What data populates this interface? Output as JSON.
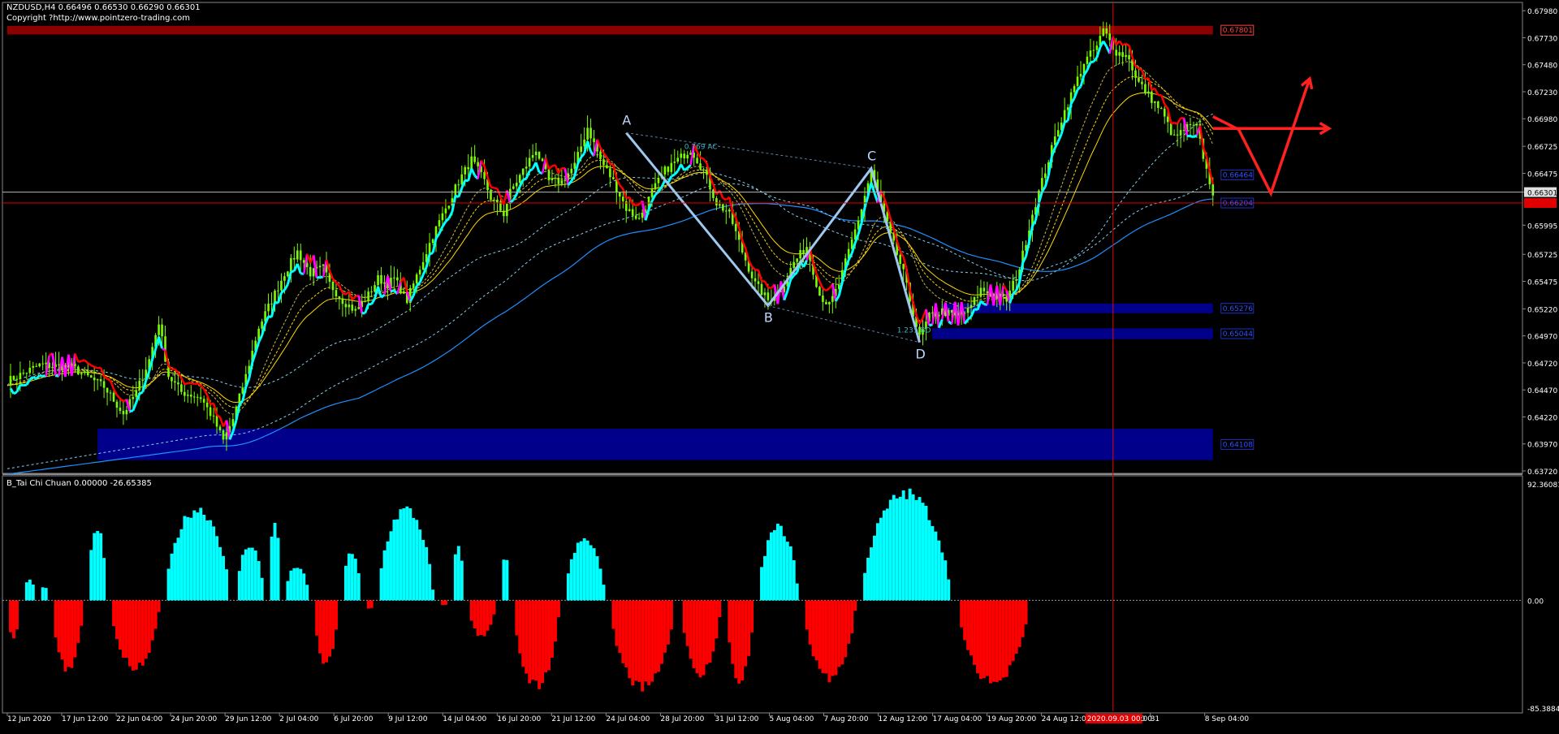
{
  "header": {
    "symbol_line": "NZDUSD,H4  0.66496 0.66530 0.66290 0.66301",
    "copyright": "Copyright ?http://www.pointzero-trading.com",
    "indicator_line": "B_Tai Chi Chuan 0.00000 -26.65385"
  },
  "colors": {
    "background": "#000000",
    "bull_bar": "#7CFC00",
    "trail_bull": "#00FFFF",
    "trail_bear": "#FF0000",
    "trail_transition": "#FF00FF",
    "zone": "#00008B",
    "resistance_zone": "#8B0000",
    "hist_pos": "#00FFFF",
    "hist_neg": "#FF0000",
    "ma_slow": "#1E90FF",
    "ma_dashed": "#87CEEB",
    "ma_yellow": "#FFD700",
    "projection": "#FF2020"
  },
  "chart_data": [
    {
      "type": "candlestick",
      "name": "NZDUSD,H4",
      "ylim": [
        0.6372,
        0.68004
      ],
      "y_ticks": [
        "0.67980",
        "0.67730",
        "0.67480",
        "0.67230",
        "0.66980",
        "0.66725",
        "0.66475",
        "0.66301",
        "0.65995",
        "0.65725",
        "0.65475",
        "0.65220",
        "0.64970",
        "0.64720",
        "0.64470",
        "0.64220",
        "0.63970",
        "0.63720"
      ],
      "current_price": "0.66301",
      "x_ticks": [
        "12 Jun 2020",
        "17 Jun 12:00",
        "22 Jun 04:00",
        "24 Jun 20:00",
        "29 Jun 12:00",
        "2 Jul 04:00",
        "6 Jul 20:00",
        "9 Jul 12:00",
        "14 Jul 04:00",
        "16 Jul 20:00",
        "21 Jul 12:00",
        "24 Jul 04:00",
        "28 Jul 20:00",
        "31 Jul 12:00",
        "5 Aug 04:00",
        "7 Aug 20:00",
        "12 Aug 12:00",
        "17 Aug 04:00",
        "19 Aug 20:00",
        "24 Aug 12:00",
        "27 Aug 04:00",
        "31",
        "8 Sep 04:00"
      ],
      "highlighted_time": "2020.09.03 00:00",
      "price_path": [
        [
          0,
          0.6455
        ],
        [
          10,
          0.647
        ],
        [
          20,
          0.6468
        ],
        [
          30,
          0.645
        ],
        [
          36,
          0.6425
        ],
        [
          40,
          0.6445
        ],
        [
          44,
          0.6475
        ],
        [
          47,
          0.651
        ],
        [
          50,
          0.646
        ],
        [
          54,
          0.6445
        ],
        [
          60,
          0.644
        ],
        [
          64,
          0.642
        ],
        [
          67,
          0.64
        ],
        [
          70,
          0.642
        ],
        [
          74,
          0.646
        ],
        [
          78,
          0.6505
        ],
        [
          82,
          0.653
        ],
        [
          86,
          0.6555
        ],
        [
          90,
          0.6575
        ],
        [
          94,
          0.6555
        ],
        [
          98,
          0.656
        ],
        [
          100,
          0.6545
        ],
        [
          104,
          0.653
        ],
        [
          108,
          0.652
        ],
        [
          112,
          0.6535
        ],
        [
          115,
          0.655
        ],
        [
          118,
          0.6545
        ],
        [
          120,
          0.655
        ],
        [
          124,
          0.653
        ],
        [
          128,
          0.656
        ],
        [
          132,
          0.659
        ],
        [
          136,
          0.6615
        ],
        [
          140,
          0.664
        ],
        [
          144,
          0.666
        ],
        [
          148,
          0.664
        ],
        [
          150,
          0.6625
        ],
        [
          154,
          0.661
        ],
        [
          156,
          0.663
        ],
        [
          160,
          0.665
        ],
        [
          164,
          0.667
        ],
        [
          166,
          0.6655
        ],
        [
          168,
          0.664
        ],
        [
          172,
          0.664
        ],
        [
          176,
          0.6655
        ],
        [
          180,
          0.669
        ],
        [
          184,
          0.666
        ],
        [
          188,
          0.664
        ],
        [
          192,
          0.6615
        ],
        [
          196,
          0.6605
        ],
        [
          200,
          0.663
        ],
        [
          204,
          0.665
        ],
        [
          208,
          0.666
        ],
        [
          212,
          0.667
        ],
        [
          216,
          0.665
        ],
        [
          220,
          0.662
        ],
        [
          224,
          0.661
        ],
        [
          228,
          0.6575
        ],
        [
          232,
          0.6545
        ],
        [
          236,
          0.653
        ],
        [
          240,
          0.654
        ],
        [
          244,
          0.6565
        ],
        [
          248,
          0.658
        ],
        [
          252,
          0.6535
        ],
        [
          255,
          0.6525
        ],
        [
          258,
          0.6545
        ],
        [
          262,
          0.6585
        ],
        [
          265,
          0.6615
        ],
        [
          268,
          0.665
        ],
        [
          270,
          0.663
        ],
        [
          274,
          0.659
        ],
        [
          278,
          0.6555
        ],
        [
          280,
          0.653
        ],
        [
          283,
          0.6495
        ],
        [
          286,
          0.6515
        ],
        [
          290,
          0.652
        ],
        [
          294,
          0.6515
        ],
        [
          298,
          0.652
        ],
        [
          302,
          0.654
        ],
        [
          306,
          0.6535
        ],
        [
          310,
          0.653
        ],
        [
          314,
          0.656
        ],
        [
          318,
          0.661
        ],
        [
          322,
          0.665
        ],
        [
          326,
          0.669
        ],
        [
          330,
          0.672
        ],
        [
          334,
          0.675
        ],
        [
          338,
          0.6765
        ],
        [
          340,
          0.678
        ],
        [
          344,
          0.676
        ],
        [
          348,
          0.6755
        ],
        [
          350,
          0.6735
        ],
        [
          354,
          0.672
        ],
        [
          358,
          0.6705
        ],
        [
          362,
          0.668
        ],
        [
          366,
          0.669
        ],
        [
          369,
          0.669
        ],
        [
          372,
          0.665
        ],
        [
          374,
          0.663
        ]
      ],
      "pattern_points": [
        {
          "label": "A",
          "bar": 192,
          "price": 0.6685
        },
        {
          "label": "B",
          "bar": 236,
          "price": 0.6525
        },
        {
          "label": "C",
          "bar": 268,
          "price": 0.6652
        },
        {
          "label": "D",
          "bar": 283,
          "price": 0.6491
        }
      ],
      "pattern_ratios": [
        {
          "label": "0.769 AC",
          "bar": 210,
          "price": 0.667
        },
        {
          "label": "1.231 BD",
          "bar": 276,
          "price": 0.65
        }
      ],
      "zones": [
        {
          "type": "resistance",
          "from_bar": 0,
          "to_bar": 374,
          "y0": 0.6776,
          "y1": 0.6784,
          "label": "0.67801"
        },
        {
          "type": "support",
          "from_bar": 290,
          "to_bar": 374,
          "y0": 0.6518,
          "y1": 0.6527,
          "label": "0.65276"
        },
        {
          "type": "support",
          "from_bar": 287,
          "to_bar": 374,
          "y0": 0.6494,
          "y1": 0.6504,
          "label": "0.65044"
        },
        {
          "type": "support",
          "from_bar": 28,
          "to_bar": 374,
          "y0": 0.6382,
          "y1": 0.6411,
          "label": "0.64108"
        }
      ],
      "right_labels": [
        {
          "value": 0.6646,
          "label": "0.66464"
        },
        {
          "value": 0.662,
          "label": "0.66204"
        }
      ],
      "projection": [
        [
          374,
          0.67
        ],
        [
          382,
          0.6688
        ],
        [
          392,
          0.6629
        ],
        [
          404,
          0.6735
        ]
      ],
      "projection_horizontal": {
        "from": 374,
        "to": 410,
        "value": 0.6689
      },
      "current_line": 0.66301,
      "red_hline": 0.662
    },
    {
      "type": "histogram",
      "name": "B_Tai Chi Chuan",
      "ylim": [
        -85.38848,
        92.36081
      ],
      "y_ticks": [
        "92.36081",
        "0.00",
        "-85.38848"
      ],
      "segments": [
        {
          "from": 0,
          "to": 4,
          "peak": -30
        },
        {
          "from": 5,
          "to": 9,
          "peak": 18
        },
        {
          "from": 10,
          "to": 13,
          "peak": 12
        },
        {
          "from": 14,
          "to": 24,
          "peak": -58
        },
        {
          "from": 25,
          "to": 31,
          "peak": 60
        },
        {
          "from": 32,
          "to": 48,
          "peak": -55
        },
        {
          "from": 49,
          "to": 70,
          "peak": 75
        },
        {
          "from": 71,
          "to": 80,
          "peak": 46
        },
        {
          "from": 81,
          "to": 85,
          "peak": 66
        },
        {
          "from": 86,
          "to": 94,
          "peak": 28
        },
        {
          "from": 95,
          "to": 103,
          "peak": -52
        },
        {
          "from": 104,
          "to": 110,
          "peak": 40
        },
        {
          "from": 111,
          "to": 114,
          "peak": -7
        },
        {
          "from": 115,
          "to": 133,
          "peak": 75
        },
        {
          "from": 134,
          "to": 137,
          "peak": -4
        },
        {
          "from": 138,
          "to": 142,
          "peak": 44
        },
        {
          "from": 143,
          "to": 152,
          "peak": -30
        },
        {
          "from": 153,
          "to": 156,
          "peak": 36
        },
        {
          "from": 157,
          "to": 172,
          "peak": -70
        },
        {
          "from": 173,
          "to": 186,
          "peak": 50
        },
        {
          "from": 187,
          "to": 208,
          "peak": -72
        },
        {
          "from": 209,
          "to": 222,
          "peak": -60
        },
        {
          "from": 223,
          "to": 232,
          "peak": -65
        },
        {
          "from": 233,
          "to": 246,
          "peak": 60
        },
        {
          "from": 247,
          "to": 264,
          "peak": -64
        },
        {
          "from": 265,
          "to": 294,
          "peak": 88
        },
        {
          "from": 295,
          "to": 318,
          "peak": -68
        },
        {
          "from": 319,
          "to": 374,
          "peak": 0
        }
      ]
    }
  ]
}
